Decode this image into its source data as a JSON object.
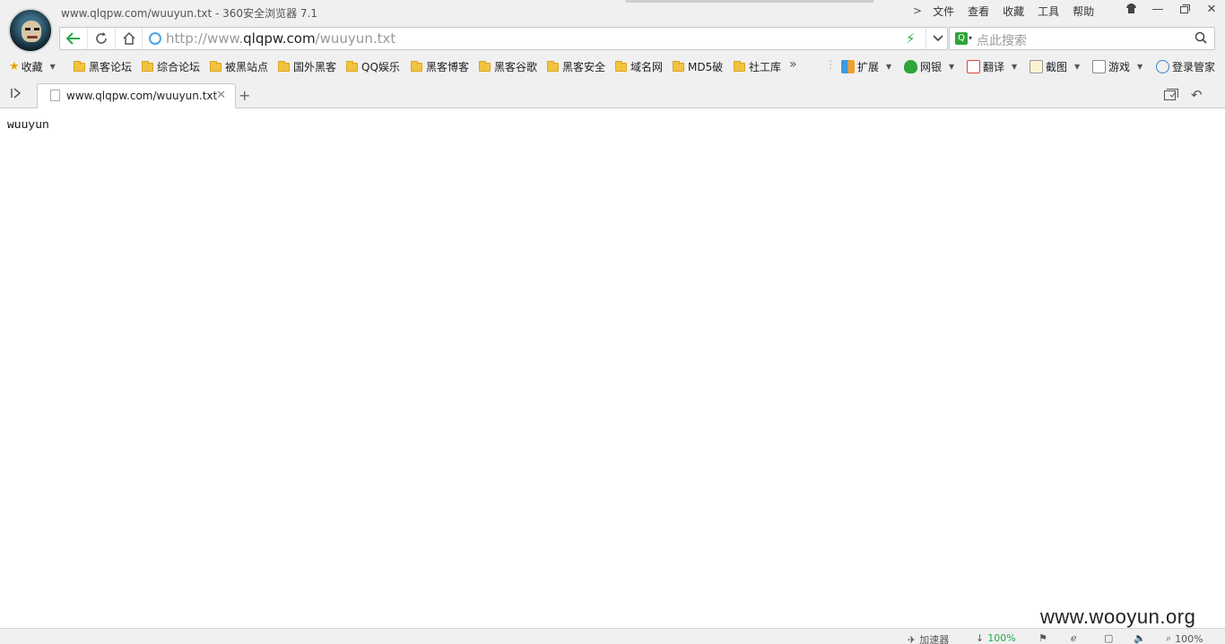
{
  "window": {
    "title": "www.qlqpw.com/wuuyun.txt - 360安全浏览器 7.1",
    "menu": [
      "文件",
      "查看",
      "收藏",
      "工具",
      "帮助"
    ]
  },
  "address": {
    "url_prefix": "http://www.",
    "url_domain": "qlqpw.com",
    "url_path": "/wuuyun.txt"
  },
  "search": {
    "placeholder": "点此搜索"
  },
  "bookmarks": {
    "favorites_label": "收藏",
    "folders": [
      "黑客论坛",
      "综合论坛",
      "被黑站点",
      "国外黑客",
      "QQ娱乐",
      "黑客博客",
      "黑客谷歌",
      "黑客安全",
      "域名网",
      "MD5破",
      "社工库"
    ],
    "more": "»",
    "extensions": [
      "扩展",
      "网银",
      "翻译",
      "截图",
      "游戏",
      "登录管家"
    ]
  },
  "tabs": [
    {
      "title": "www.qlqpw.com/wuuyun.txt",
      "active": true
    }
  ],
  "page": {
    "body_text": "wuuyun"
  },
  "statusbar": {
    "accelerator": "加速器",
    "download": "100%",
    "zoom": "100%"
  },
  "watermark": "www.wooyun.org",
  "colors": {
    "chrome_bg": "#f0f0f0",
    "accent_green": "#27b14a",
    "link_blue": "#4aa3e8"
  }
}
